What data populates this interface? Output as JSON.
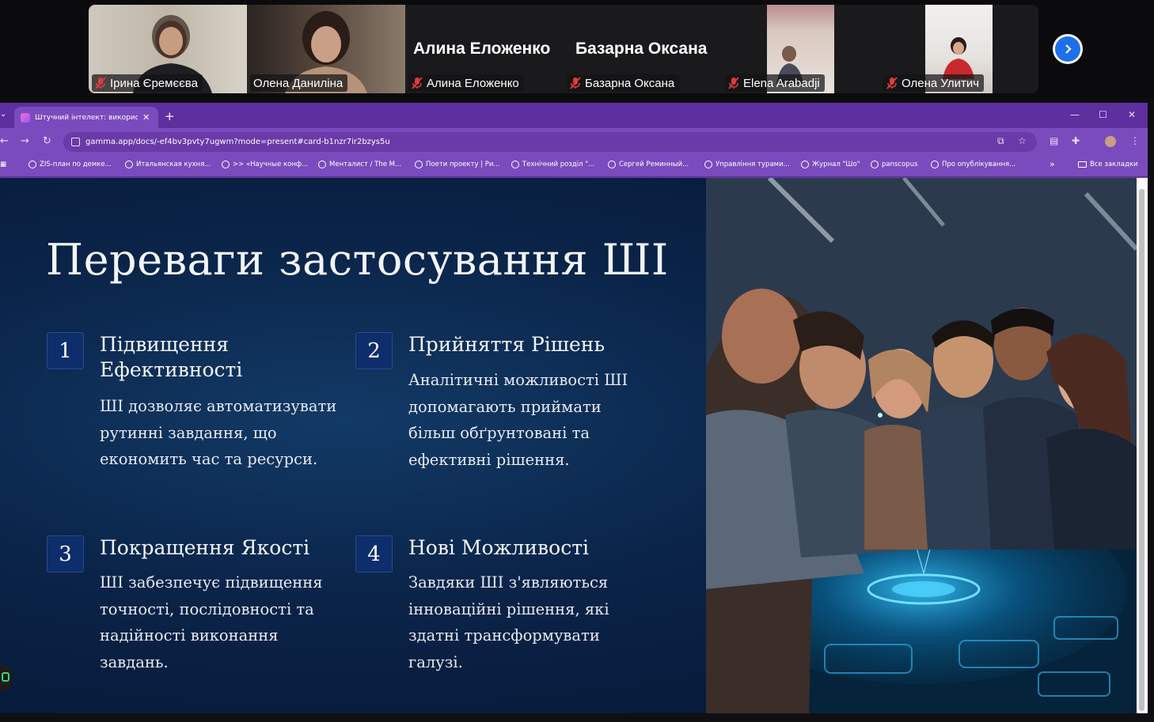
{
  "participants": [
    {
      "name": "Ірина Єремєєва",
      "muted": true,
      "has_video": true
    },
    {
      "name": "Олена Даниліна",
      "muted": false,
      "has_video": true,
      "speaking": true
    },
    {
      "name": "Алина Еложенко",
      "muted": true,
      "has_video": false
    },
    {
      "name": "Базарна Оксана",
      "muted": true,
      "has_video": false
    },
    {
      "name": "Elena Arabadji",
      "muted": true,
      "has_video": true
    },
    {
      "name": "Олена Улитич",
      "muted": true,
      "has_video": true
    }
  ],
  "browser": {
    "tab_title": "Штучний інтелект: використан",
    "tab_close": "✕",
    "new_tab": "+",
    "url": "gamma.app/docs/-ef4bv3pvty7ugwm?mode=present#card-b1nzr7ir2bzys5u",
    "bookmarks": [
      "ZIS-план по демке...",
      "Итальянская кухня...",
      ">> «Научные конф...",
      "Менталист / The M...",
      "Поети проекту | Ри...",
      "Технічний розділ \"...",
      "Сергей Реминный...",
      "Управління турами...",
      "Журнал \"Шо\"",
      "panscopus",
      "Про опублікування..."
    ],
    "bookmarks_more": "»",
    "all_bookmarks": "Все закладки"
  },
  "slide": {
    "title": "Переваги застосування ШІ",
    "cards": [
      {
        "num": "1",
        "head": "Підвищення Ефективності",
        "body": "ШІ дозволяє автоматизувати рутинні завдання, що економить час та ресурси."
      },
      {
        "num": "2",
        "head": "Прийняття Рішень",
        "body": "Аналітичні можливості ШІ допомагають приймати більш обґрунтовані та ефективні рішення."
      },
      {
        "num": "3",
        "head": "Покращення Якості",
        "body": "ШІ забезпечує підвищення точності, послідовності та надійності виконання завдань."
      },
      {
        "num": "4",
        "head": "Нові Можливості",
        "body": "Завдяки ШІ з'являються інноваційні рішення, які здатні трансформувати галузі."
      }
    ]
  },
  "colors": {
    "accent": "#6a3aa8",
    "number_box": "#0e2d6b",
    "speaking_border": "#2fd07a"
  }
}
